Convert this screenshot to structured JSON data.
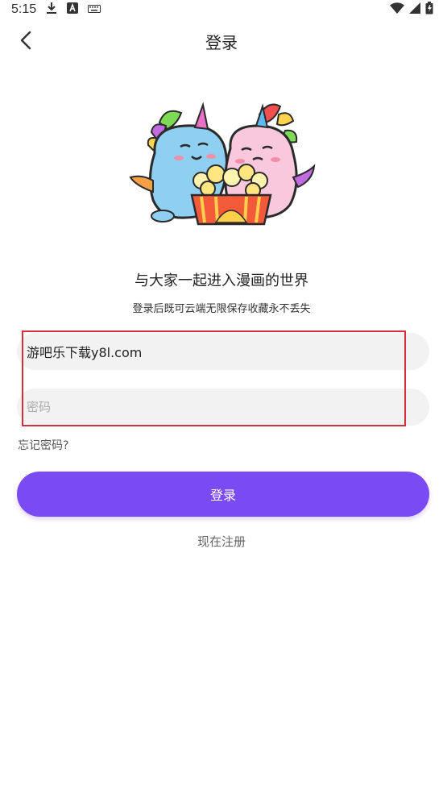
{
  "status_bar": {
    "time": "5:15",
    "left_icons": [
      "download-icon",
      "font-a-icon",
      "keyboard-icon"
    ],
    "right_icons": [
      "wifi-icon",
      "signal-icon",
      "battery-icon"
    ]
  },
  "header": {
    "title": "登录",
    "back_icon": "chevron-left-icon"
  },
  "illustration": {
    "description_icon": "unicorn-mascots-popcorn-icon"
  },
  "slogan": "与大家一起进入漫画的世界",
  "sub_slogan": "登录后既可云端无限保存收藏永不丢失",
  "form": {
    "username_value": "游吧乐下载y8l.com",
    "password_placeholder": "密码",
    "forgot_label": "忘记密码?",
    "login_label": "登录",
    "register_label": "现在注册"
  },
  "colors": {
    "accent": "#7a4af3",
    "field_bg": "#f2f2f2",
    "highlight": "#d62f3a"
  }
}
